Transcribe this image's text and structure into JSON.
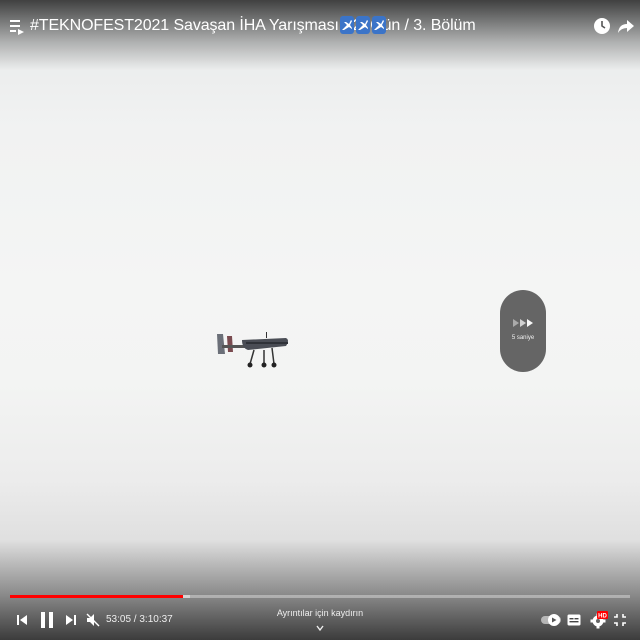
{
  "header": {
    "title": "#TEKNOFEST2021 Savaşan İHA Yarışması - 2. Gün / 3. Bölüm",
    "title_emojis": [
      "airplane-emoji",
      "airplane-emoji",
      "airplane-emoji"
    ],
    "icons": [
      "playlist-icon",
      "clock-icon",
      "share-icon"
    ]
  },
  "seek_overlay": {
    "label": "5 saniye",
    "icon": "fast-forward-arrows-icon"
  },
  "controls": {
    "current_time": "53:05",
    "separator": " / ",
    "duration": "3:10:37",
    "time_text": "53:05 / 3:10:37",
    "details_hint": "Ayrıntılar için kaydırın",
    "settings_badge": "HD",
    "icons": [
      "previous-icon",
      "pause-icon",
      "next-icon",
      "muted-volume-icon",
      "autoplay-toggle-icon",
      "captions-icon",
      "settings-icon",
      "exit-fullscreen-icon"
    ]
  },
  "progress": {
    "played_fraction": 0.2786,
    "buffered_fraction": 0.29
  },
  "colors": {
    "progress_played": "#ff0000",
    "hd_badge": "#ff0000",
    "emoji_plane_bg": "#3b74c8"
  }
}
